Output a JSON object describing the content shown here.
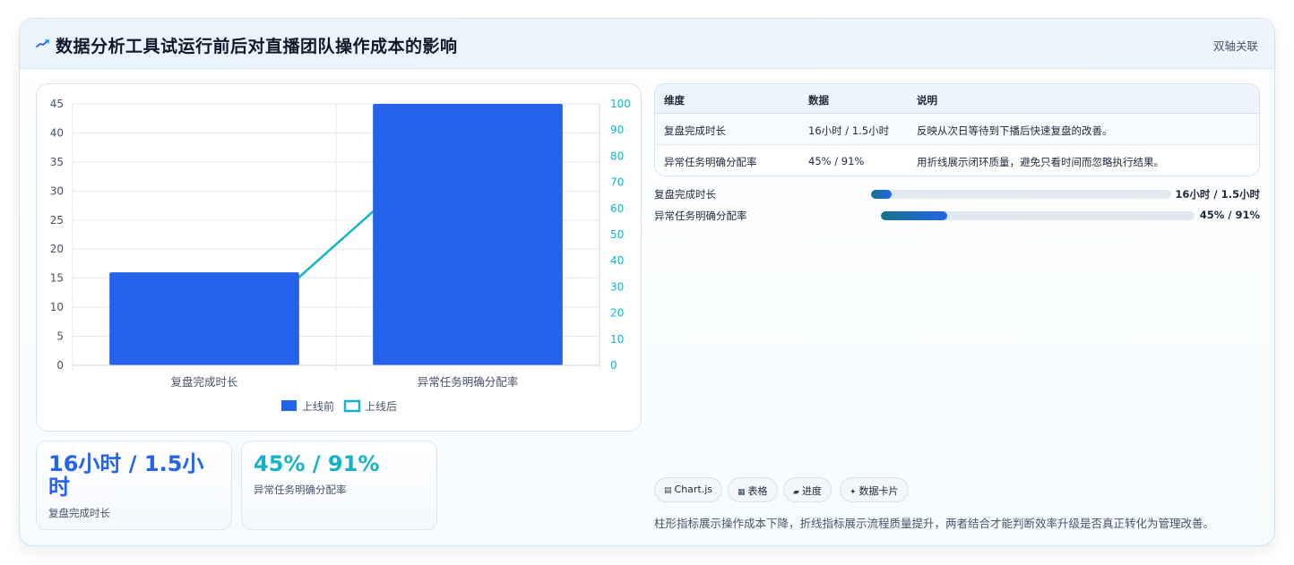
{
  "header": {
    "icon": "trend-icon",
    "title": "数据分析工具试运行前后对直播团队操作成本的影响",
    "tag": "双轴关联"
  },
  "chart_data": {
    "type": "bar",
    "categories": [
      "复盘完成时长",
      "异常任务明确分配率"
    ],
    "series": [
      {
        "name": "上线前",
        "type": "bar",
        "axis": "left",
        "values": [
          16,
          45
        ],
        "color": "#2563eb"
      },
      {
        "name": "上线后",
        "type": "line",
        "axis": "right",
        "values": [
          1.5,
          91
        ],
        "color": "#16b3c6"
      }
    ],
    "y_left": {
      "ylim": [
        0,
        45
      ],
      "ticks": [
        0,
        5,
        10,
        15,
        20,
        25,
        30,
        35,
        40,
        45
      ]
    },
    "y_right": {
      "ylim": [
        0,
        100
      ],
      "ticks": [
        0,
        10,
        20,
        30,
        40,
        50,
        60,
        70,
        80,
        90,
        100
      ]
    },
    "grid": true,
    "legend": "bottom"
  },
  "kpis": [
    {
      "value": "16小时 / 1.5小时",
      "label": "复盘完成时长"
    },
    {
      "value": "45% / 91%",
      "label": "异常任务明确分配率"
    }
  ],
  "table": {
    "headers": [
      "维度",
      "数据",
      "说明"
    ],
    "rows": [
      [
        "复盘完成时长",
        "16小时 / 1.5小时",
        "反映从次日等待到下播后快速复盘的改善。"
      ],
      [
        "异常任务明确分配率",
        "45% / 91%",
        "用折线展示闭环质量，避免只看时间而忽略执行结果。"
      ]
    ]
  },
  "progress": [
    {
      "label": "复盘完成时长",
      "value": "16小时 / 1.5小时",
      "fraction": 0.07
    },
    {
      "label": "异常任务明确分配率",
      "value": "45% / 91%",
      "fraction": 0.21
    }
  ],
  "chips": [
    {
      "icon": "chart-icon",
      "glyph": "▤",
      "label": "Chart.js"
    },
    {
      "icon": "table-icon",
      "glyph": "▦",
      "label": "表格"
    },
    {
      "icon": "progress-icon",
      "glyph": "▰",
      "label": "进度"
    },
    {
      "icon": "sparkle-icon",
      "glyph": "✦",
      "label": "数据卡片"
    }
  ],
  "footnote": "柱形指标展示操作成本下降，折线指标展示流程质量提升，两者结合才能判断效率升级是否真正转化为管理改善。"
}
